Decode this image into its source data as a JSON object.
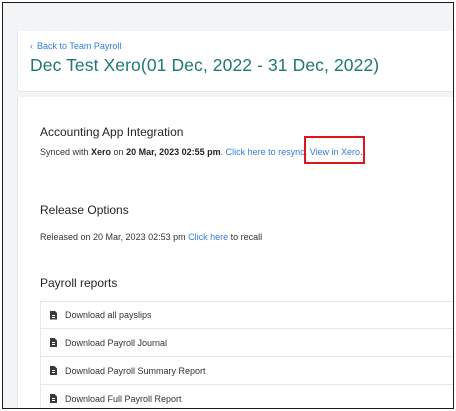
{
  "header": {
    "back_label": "Back to Team Payroll",
    "back_chevron": "‹",
    "title": "Dec Test Xero(01 Dec, 2022 - 31 Dec, 2022)"
  },
  "accounting": {
    "title": "Accounting App Integration",
    "synced_prefix": "Synced with ",
    "app_name": "Xero",
    "synced_on": " on ",
    "sync_datetime": "20 Mar, 2023 02:55 pm",
    "period": ". ",
    "resync_label": "Click here to resync",
    "view_label": "View in Xero",
    "end": "."
  },
  "release": {
    "title": "Release Options",
    "released_text": "Released on 20 Mar, 2023 02:53 pm ",
    "recall_link": "Click here",
    "recall_suffix": " to recall"
  },
  "reports": {
    "title": "Payroll reports",
    "items": [
      {
        "label": "Download all payslips",
        "icon": "file-icon"
      },
      {
        "label": "Download Payroll Journal",
        "icon": "file-icon"
      },
      {
        "label": "Download Payroll Summary Report",
        "icon": "file-icon"
      },
      {
        "label": "Download Full Payroll Report",
        "icon": "file-icon"
      }
    ]
  },
  "colors": {
    "title_teal": "#1d7874",
    "link_blue": "#2f7de1",
    "highlight_red": "#e0141c"
  }
}
